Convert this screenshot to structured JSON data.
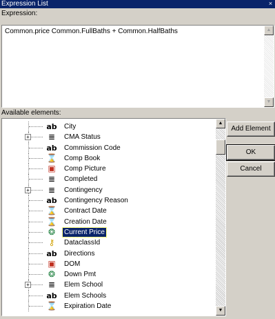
{
  "window": {
    "title": "Expression List",
    "close_glyph": "×"
  },
  "expression": {
    "label": "Expression:",
    "value": "Common.price Common.FullBaths + Common.HalfBaths"
  },
  "elements": {
    "label": "Available elements:",
    "items": [
      {
        "label": "City",
        "icon": "text-ab-icon",
        "expandable": false
      },
      {
        "label": "CMA Status",
        "icon": "list-icon",
        "expandable": true
      },
      {
        "label": "Commission Code",
        "icon": "text-ab-icon",
        "expandable": false
      },
      {
        "label": "Comp Book",
        "icon": "hourglass-icon",
        "expandable": false
      },
      {
        "label": "Comp Picture",
        "icon": "picture-icon",
        "expandable": false
      },
      {
        "label": "Completed",
        "icon": "list-icon",
        "expandable": false
      },
      {
        "label": "Contingency",
        "icon": "list-icon",
        "expandable": true
      },
      {
        "label": "Contingency Reason",
        "icon": "text-ab-icon",
        "expandable": false
      },
      {
        "label": "Contract Date",
        "icon": "hourglass-icon",
        "expandable": false
      },
      {
        "label": "Creation Date",
        "icon": "hourglass-icon",
        "expandable": false
      },
      {
        "label": "Current Price",
        "icon": "money-icon",
        "expandable": false,
        "selected": true
      },
      {
        "label": "DataclassId",
        "icon": "key-icon",
        "expandable": false
      },
      {
        "label": "Directions",
        "icon": "text-ab-icon",
        "expandable": false
      },
      {
        "label": "DOM",
        "icon": "picture-icon",
        "expandable": false
      },
      {
        "label": "Down Pmt",
        "icon": "money-icon",
        "expandable": false
      },
      {
        "label": "Elem School",
        "icon": "list-icon",
        "expandable": true
      },
      {
        "label": "Elem Schools",
        "icon": "text-ab-icon",
        "expandable": false
      },
      {
        "label": "Expiration Date",
        "icon": "hourglass-icon",
        "expandable": false
      }
    ]
  },
  "buttons": {
    "add_element": "Add Element",
    "ok": "OK",
    "cancel": "Cancel"
  },
  "glyphs": {
    "up": "▲",
    "down": "▼",
    "plus": "+"
  },
  "colors": {
    "titlebar": "#0a246a",
    "selection": "#0a246a",
    "face": "#d4d0c8"
  }
}
